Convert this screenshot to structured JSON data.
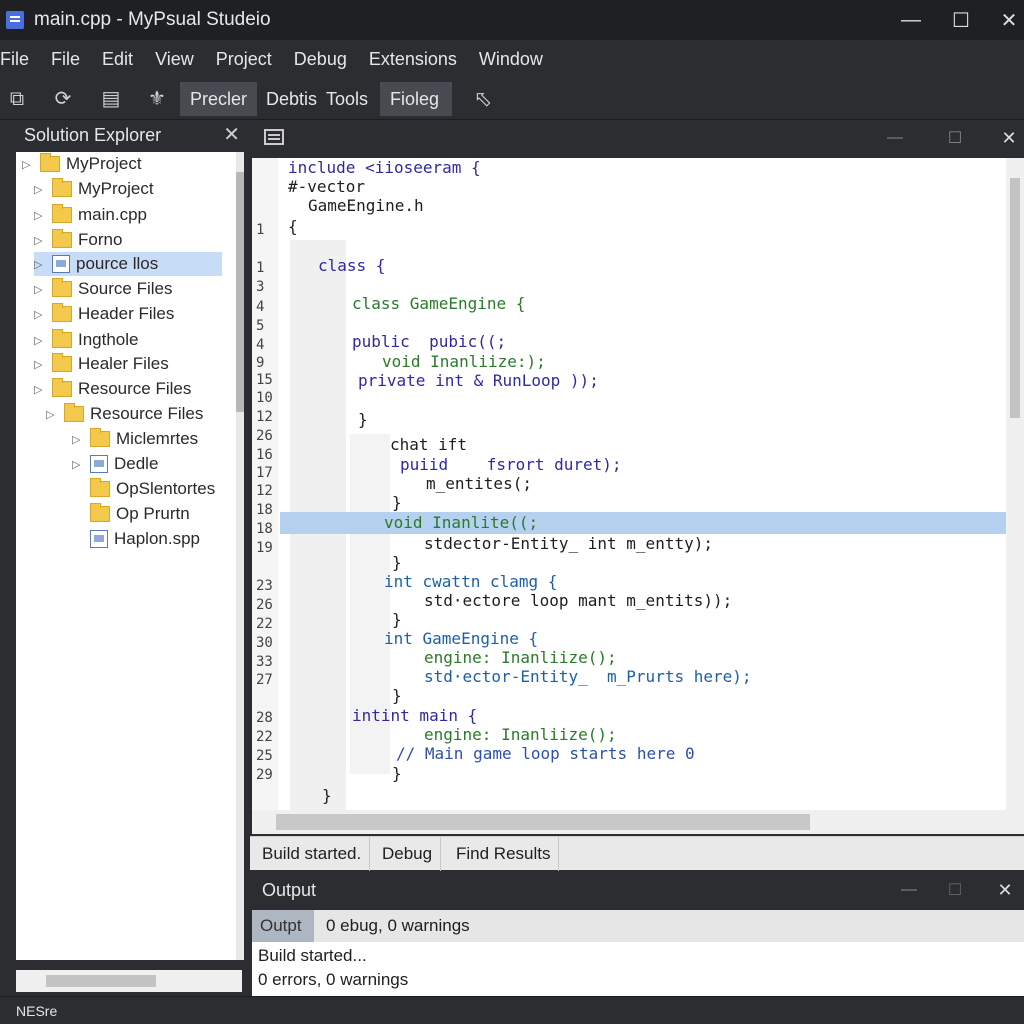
{
  "window": {
    "title": "main.cpp - MyPsual Studeio"
  },
  "menu": [
    "File",
    "File",
    "Edit",
    "View",
    "Project",
    "Debug",
    "Extensions",
    "Window"
  ],
  "toolbar": {
    "tabs": [
      "Precler",
      "Debtis",
      "Tools",
      "Fioleg"
    ]
  },
  "solution_explorer": {
    "title": "Solution Explorer",
    "items": [
      {
        "label": "MyProject",
        "icon": "folder-icon"
      },
      {
        "label": "MyProject",
        "icon": "folder-icon"
      },
      {
        "label": "main.cpp",
        "icon": "folder-icon"
      },
      {
        "label": "Forno",
        "icon": "folder-icon"
      },
      {
        "label": "pource llos",
        "icon": "file-icon"
      },
      {
        "label": "Source Files",
        "icon": "folder-icon"
      },
      {
        "label": "Header Files",
        "icon": "folder-icon"
      },
      {
        "label": "Ingthole",
        "icon": "folder-icon"
      },
      {
        "label": "Healer Files",
        "icon": "folder-icon"
      },
      {
        "label": "Resource Files",
        "icon": "folder-icon"
      },
      {
        "label": "Resource Files",
        "icon": "folder-icon"
      },
      {
        "label": "Miclemrtes",
        "icon": "folder-icon"
      },
      {
        "label": "Dedle",
        "icon": "file-icon"
      },
      {
        "label": "OpSlentortes",
        "icon": "folder-icon"
      },
      {
        "label": "Op Prurtn",
        "icon": "folder-icon"
      },
      {
        "label": "Haplon.spp",
        "icon": "file-icon"
      }
    ]
  },
  "editor": {
    "line_numbers": [
      "1",
      "1",
      "3",
      "4",
      "5",
      "4",
      "9",
      "15",
      "10",
      "12",
      "26",
      "16",
      "17",
      "12",
      "18",
      "18",
      "19",
      "23",
      "26",
      "22",
      "30",
      "33",
      "27",
      "28",
      "22",
      "25",
      "29"
    ],
    "lines": [
      "include <iioseeram {",
      "#-vector",
      "GameEngine.h",
      "{",
      "class {",
      "class GameEngine {",
      "public  pubic((;",
      "void Inanliize:);",
      "private int & RunLoop ));",
      "}",
      "chat ift",
      "puiid    fsrort duret);",
      "m_entites(;",
      "}",
      "void Inanlite((;",
      "stdector-Entity_ int m_entty);",
      "}",
      "int cwattn clamg {",
      "std·ectore loop mant m_entits));",
      "}",
      "int GameEngine {",
      "engine: Inanliize();",
      "std·ector-Entity_  m_Prurts here);",
      "}",
      "intint main {",
      "engine: Inanliize();",
      "// Main game loop starts here 0",
      "}",
      "}"
    ]
  },
  "bottom_tabs": [
    "Build started.",
    "Debug",
    "Find Results"
  ],
  "output": {
    "title": "Output",
    "label": "Outpt",
    "summary": "0 ebug, 0 warnings",
    "lines": [
      "Build started...",
      "0 errors, 0 warnings"
    ]
  },
  "status": {
    "text": "NESre"
  }
}
